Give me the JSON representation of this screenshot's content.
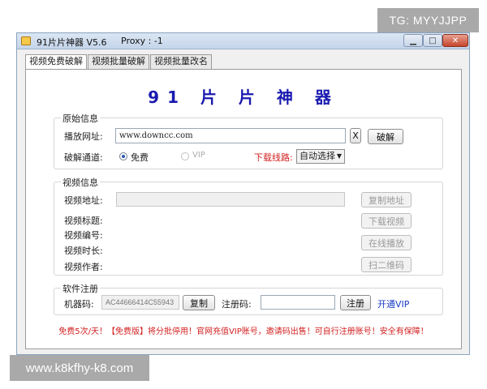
{
  "watermark_top": "TG: MYYJJPP",
  "watermark_bottom": "www.k8kfhy-k8.com",
  "window": {
    "title": "91片片神器 V5.6",
    "proxy": "Proxy : -1",
    "minimize_label": "▁",
    "maximize_label": "□",
    "close_label": "✕"
  },
  "tabs": [
    {
      "label": "视频免费破解",
      "active": true
    },
    {
      "label": "视频批量破解",
      "active": false
    },
    {
      "label": "视频批量改名",
      "active": false
    }
  ],
  "header_title": "91 片 片 神 器",
  "original_info": {
    "legend": "原始信息",
    "url_label": "播放网址:",
    "url_value": "www.downcc.com",
    "clear_label": "X",
    "crack_label": "破解",
    "channel_label": "破解通道:",
    "free_label": "免费",
    "vip_label": "VIP",
    "download_line_label": "下载线路:",
    "download_line_value": "自动选择"
  },
  "video_info": {
    "legend": "视频信息",
    "address_label": "视频地址:",
    "title_label": "视频标题:",
    "number_label": "视频编号:",
    "duration_label": "视频时长:",
    "author_label": "视频作者:",
    "copy_address_label": "复制地址",
    "download_video_label": "下载视频",
    "play_online_label": "在线播放",
    "qr_code_label": "扫二维码"
  },
  "registration": {
    "legend": "软件注册",
    "machine_code_label": "机器码:",
    "machine_code_value": "AC44666414C55943",
    "copy_label": "复制",
    "reg_code_label": "注册码:",
    "register_label": "注册",
    "open_vip_label": "开通VIP"
  },
  "footer_note": "免费5次/天！【免费版】将分批停用！官网充值VIP账号，邀请码出售！可自行注册账号！安全有保障！",
  "colors": {
    "title_blue": "#1a1ab0",
    "warning_red": "#d31f1f",
    "link_blue": "#1a3cc9"
  }
}
